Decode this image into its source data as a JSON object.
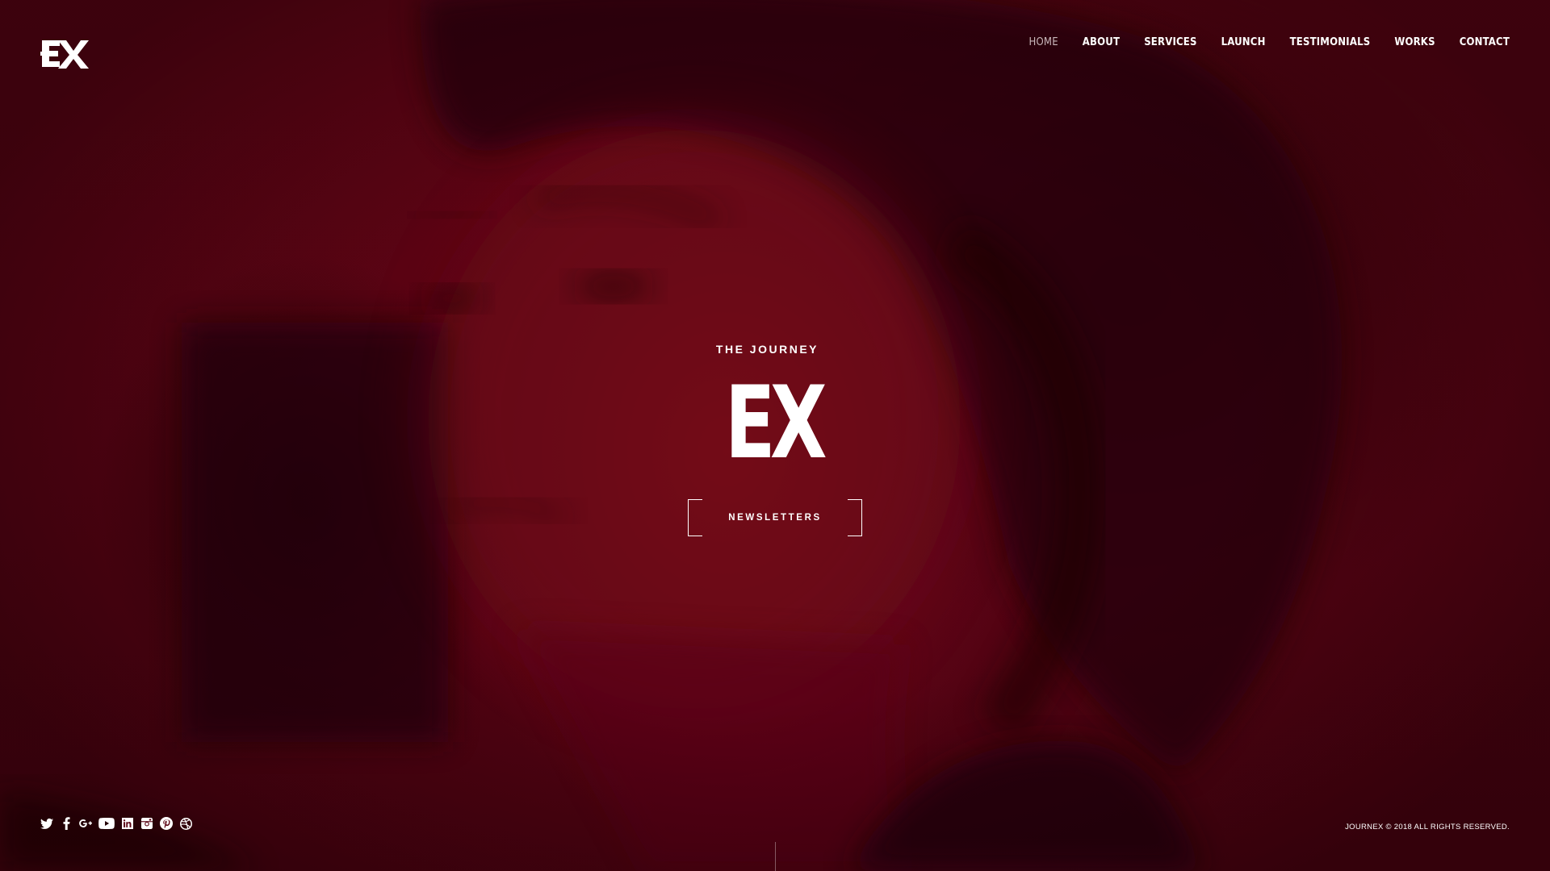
{
  "brand": {
    "logo_icon": "ex-logo-icon",
    "logo_text": "EX"
  },
  "nav": {
    "items": [
      {
        "label": "HOME",
        "active": true
      },
      {
        "label": "ABOUT",
        "active": false
      },
      {
        "label": "SERVICES",
        "active": false
      },
      {
        "label": "LAUNCH",
        "active": false
      },
      {
        "label": "TESTIMONIALS",
        "active": false
      },
      {
        "label": "WORKS",
        "active": false
      },
      {
        "label": "CONTACT",
        "active": false
      }
    ]
  },
  "hero": {
    "subtitle": "THE JOURNEY",
    "title": "EX",
    "button_label": "NEWSLETTERS"
  },
  "footer": {
    "social": [
      {
        "icon": "twitter-icon"
      },
      {
        "icon": "facebook-icon"
      },
      {
        "icon": "google-plus-icon"
      },
      {
        "icon": "youtube-icon"
      },
      {
        "icon": "linkedin-icon"
      },
      {
        "icon": "instagram-icon"
      },
      {
        "icon": "pinterest-icon"
      },
      {
        "icon": "dribbble-icon"
      }
    ],
    "copyright": "JOURNEX © 2018 ALL RIGHTS RESERVED."
  },
  "colors": {
    "background_tint": "#5e0414",
    "text": "#ffffff",
    "nav_active": "#c9b7bb"
  }
}
